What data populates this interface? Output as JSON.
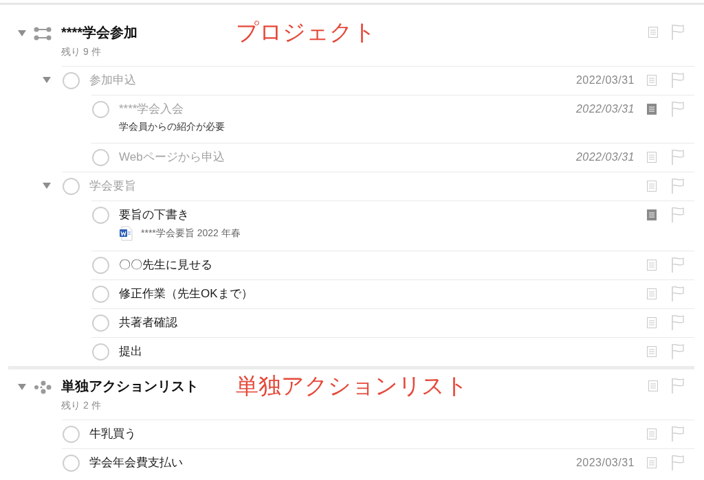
{
  "projects": [
    {
      "kind": "sequential",
      "title": "****学会参加",
      "remaining": "残り 9 件",
      "annotation": "プロジェクト",
      "expanded": true,
      "has_note": false,
      "tasks": [
        {
          "title": "参加申込",
          "dimmed": true,
          "date": "2022/03/31",
          "date_italic": false,
          "has_note": false,
          "expanded": true,
          "children": [
            {
              "title": "****学会入会",
              "dimmed": true,
              "note": "学会員からの紹介が必要",
              "date": "2022/03/31",
              "date_italic": true,
              "has_note": true
            },
            {
              "title": "Webページから申込",
              "dimmed": true,
              "date": "2022/03/31",
              "date_italic": true,
              "has_note": false
            }
          ]
        },
        {
          "title": "学会要旨",
          "dimmed": true,
          "has_note": false,
          "expanded": true,
          "children": [
            {
              "title": "要旨の下書き",
              "dimmed": false,
              "attachment": "****学会要旨 2022 年春",
              "has_note": true
            },
            {
              "title": "〇〇先生に見せる",
              "dimmed": false,
              "has_note": false
            },
            {
              "title": "修正作業（先生OKまで）",
              "dimmed": false,
              "has_note": false
            },
            {
              "title": "共著者確認",
              "dimmed": false,
              "has_note": false
            },
            {
              "title": "提出",
              "dimmed": false,
              "has_note": false
            }
          ]
        }
      ]
    },
    {
      "kind": "single_actions",
      "title": "単独アクションリスト",
      "remaining": "残り 2 件",
      "annotation": "単独アクションリスト",
      "expanded": true,
      "has_note": false,
      "tasks": [
        {
          "title": "牛乳買う",
          "dimmed": false,
          "has_note": false
        },
        {
          "title": "学会年会費支払い",
          "dimmed": false,
          "date": "2023/03/31",
          "date_italic": false,
          "has_note": false
        }
      ]
    }
  ]
}
